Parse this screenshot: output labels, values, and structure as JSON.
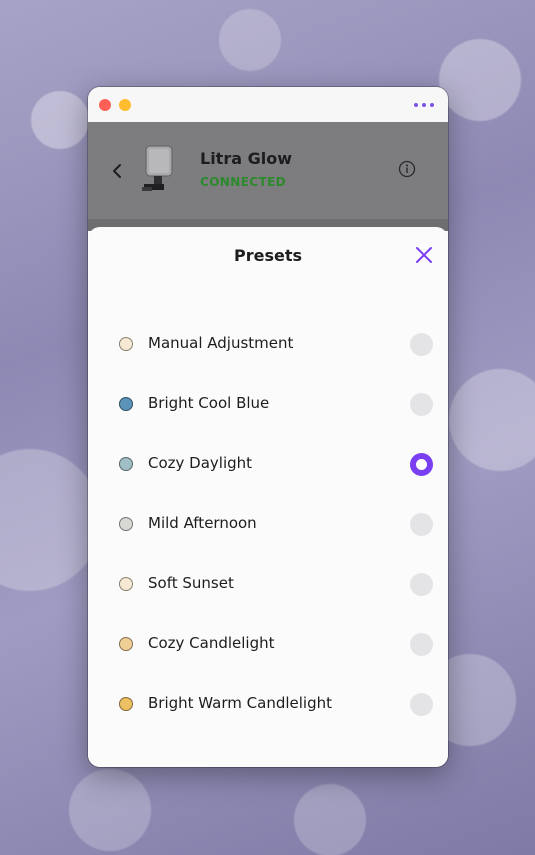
{
  "device": {
    "name": "Litra Glow",
    "status": "CONNECTED"
  },
  "sheet": {
    "title": "Presets"
  },
  "presets": [
    {
      "label": "Manual Adjustment",
      "color": "#f6ead2",
      "selected": false
    },
    {
      "label": "Bright Cool Blue",
      "color": "#5c93b8",
      "selected": false
    },
    {
      "label": "Cozy Daylight",
      "color": "#9fbfc4",
      "selected": true
    },
    {
      "label": "Mild Afternoon",
      "color": "#d8d8d4",
      "selected": false
    },
    {
      "label": "Soft Sunset",
      "color": "#f6ead2",
      "selected": false
    },
    {
      "label": "Cozy Candlelight",
      "color": "#f0cf95",
      "selected": false
    },
    {
      "label": "Bright Warm Candlelight",
      "color": "#edc064",
      "selected": false
    }
  ],
  "colors": {
    "accent": "#7a3ff2",
    "status": "#2b8a2b"
  }
}
